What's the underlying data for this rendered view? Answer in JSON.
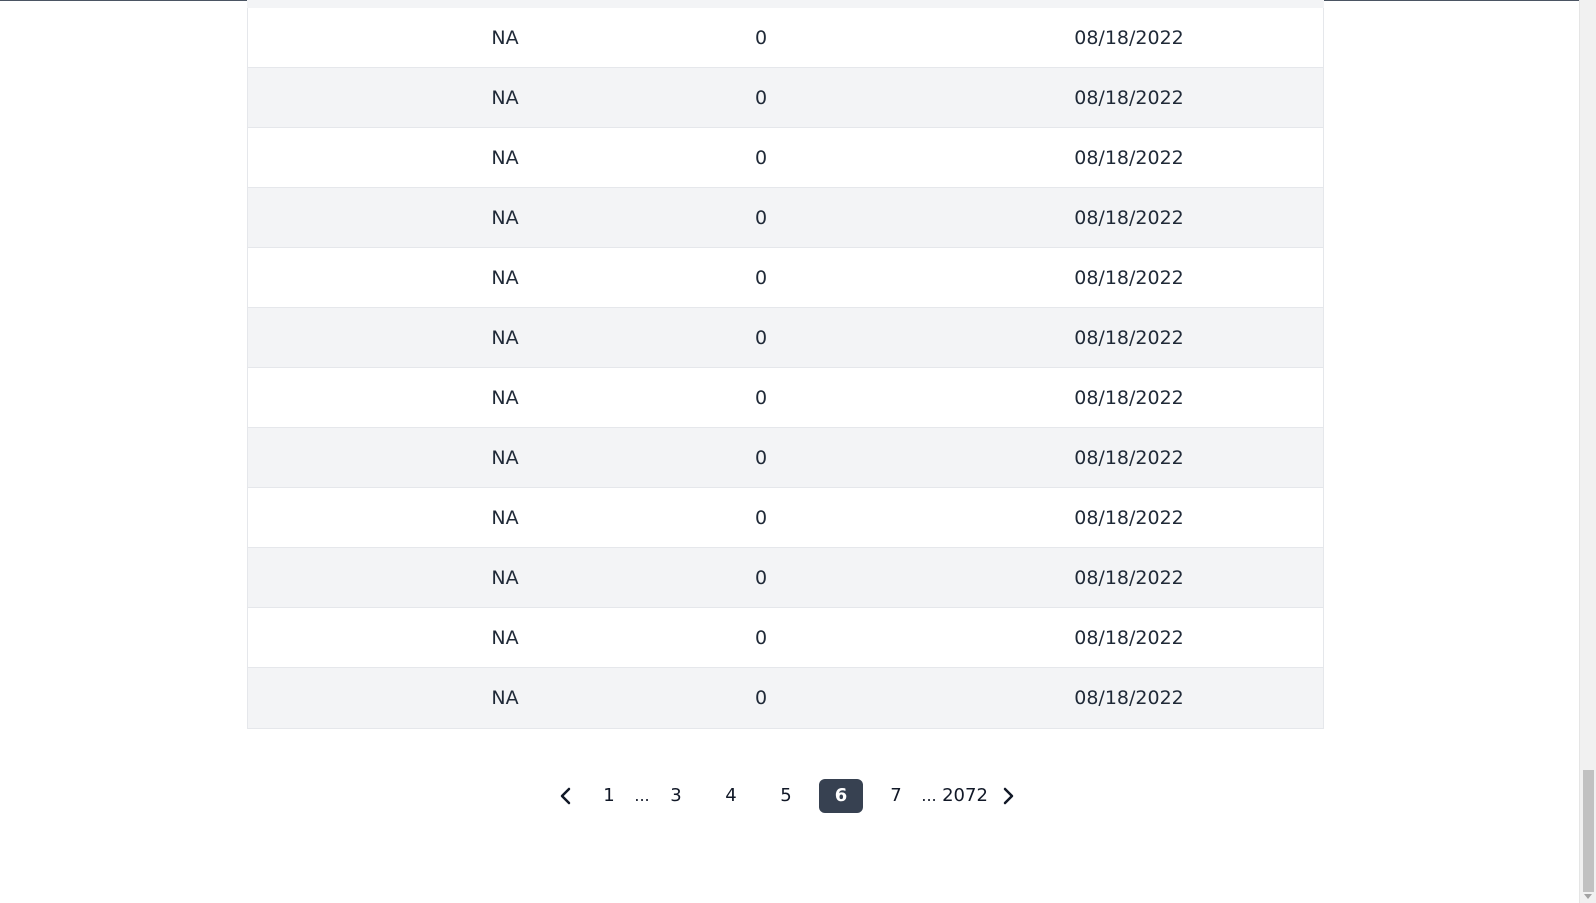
{
  "table": {
    "rows": [
      {
        "col1": "NA",
        "col2": "0",
        "col3": "08/18/2022"
      },
      {
        "col1": "NA",
        "col2": "0",
        "col3": "08/18/2022"
      },
      {
        "col1": "NA",
        "col2": "0",
        "col3": "08/18/2022"
      },
      {
        "col1": "NA",
        "col2": "0",
        "col3": "08/18/2022"
      },
      {
        "col1": "NA",
        "col2": "0",
        "col3": "08/18/2022"
      },
      {
        "col1": "NA",
        "col2": "0",
        "col3": "08/18/2022"
      },
      {
        "col1": "NA",
        "col2": "0",
        "col3": "08/18/2022"
      },
      {
        "col1": "NA",
        "col2": "0",
        "col3": "08/18/2022"
      },
      {
        "col1": "NA",
        "col2": "0",
        "col3": "08/18/2022"
      },
      {
        "col1": "NA",
        "col2": "0",
        "col3": "08/18/2022"
      },
      {
        "col1": "NA",
        "col2": "0",
        "col3": "08/18/2022"
      },
      {
        "col1": "NA",
        "col2": "0",
        "col3": "08/18/2022"
      }
    ]
  },
  "pagination": {
    "prev_icon": "chevron-left-icon",
    "next_icon": "chevron-right-icon",
    "first": "1",
    "ellipsis": "...",
    "p3": "3",
    "p4": "4",
    "p5": "5",
    "current": "6",
    "p7": "7",
    "last": "2072"
  },
  "colors": {
    "active_page_bg": "#374151",
    "row_alt_bg": "#f3f4f6"
  }
}
